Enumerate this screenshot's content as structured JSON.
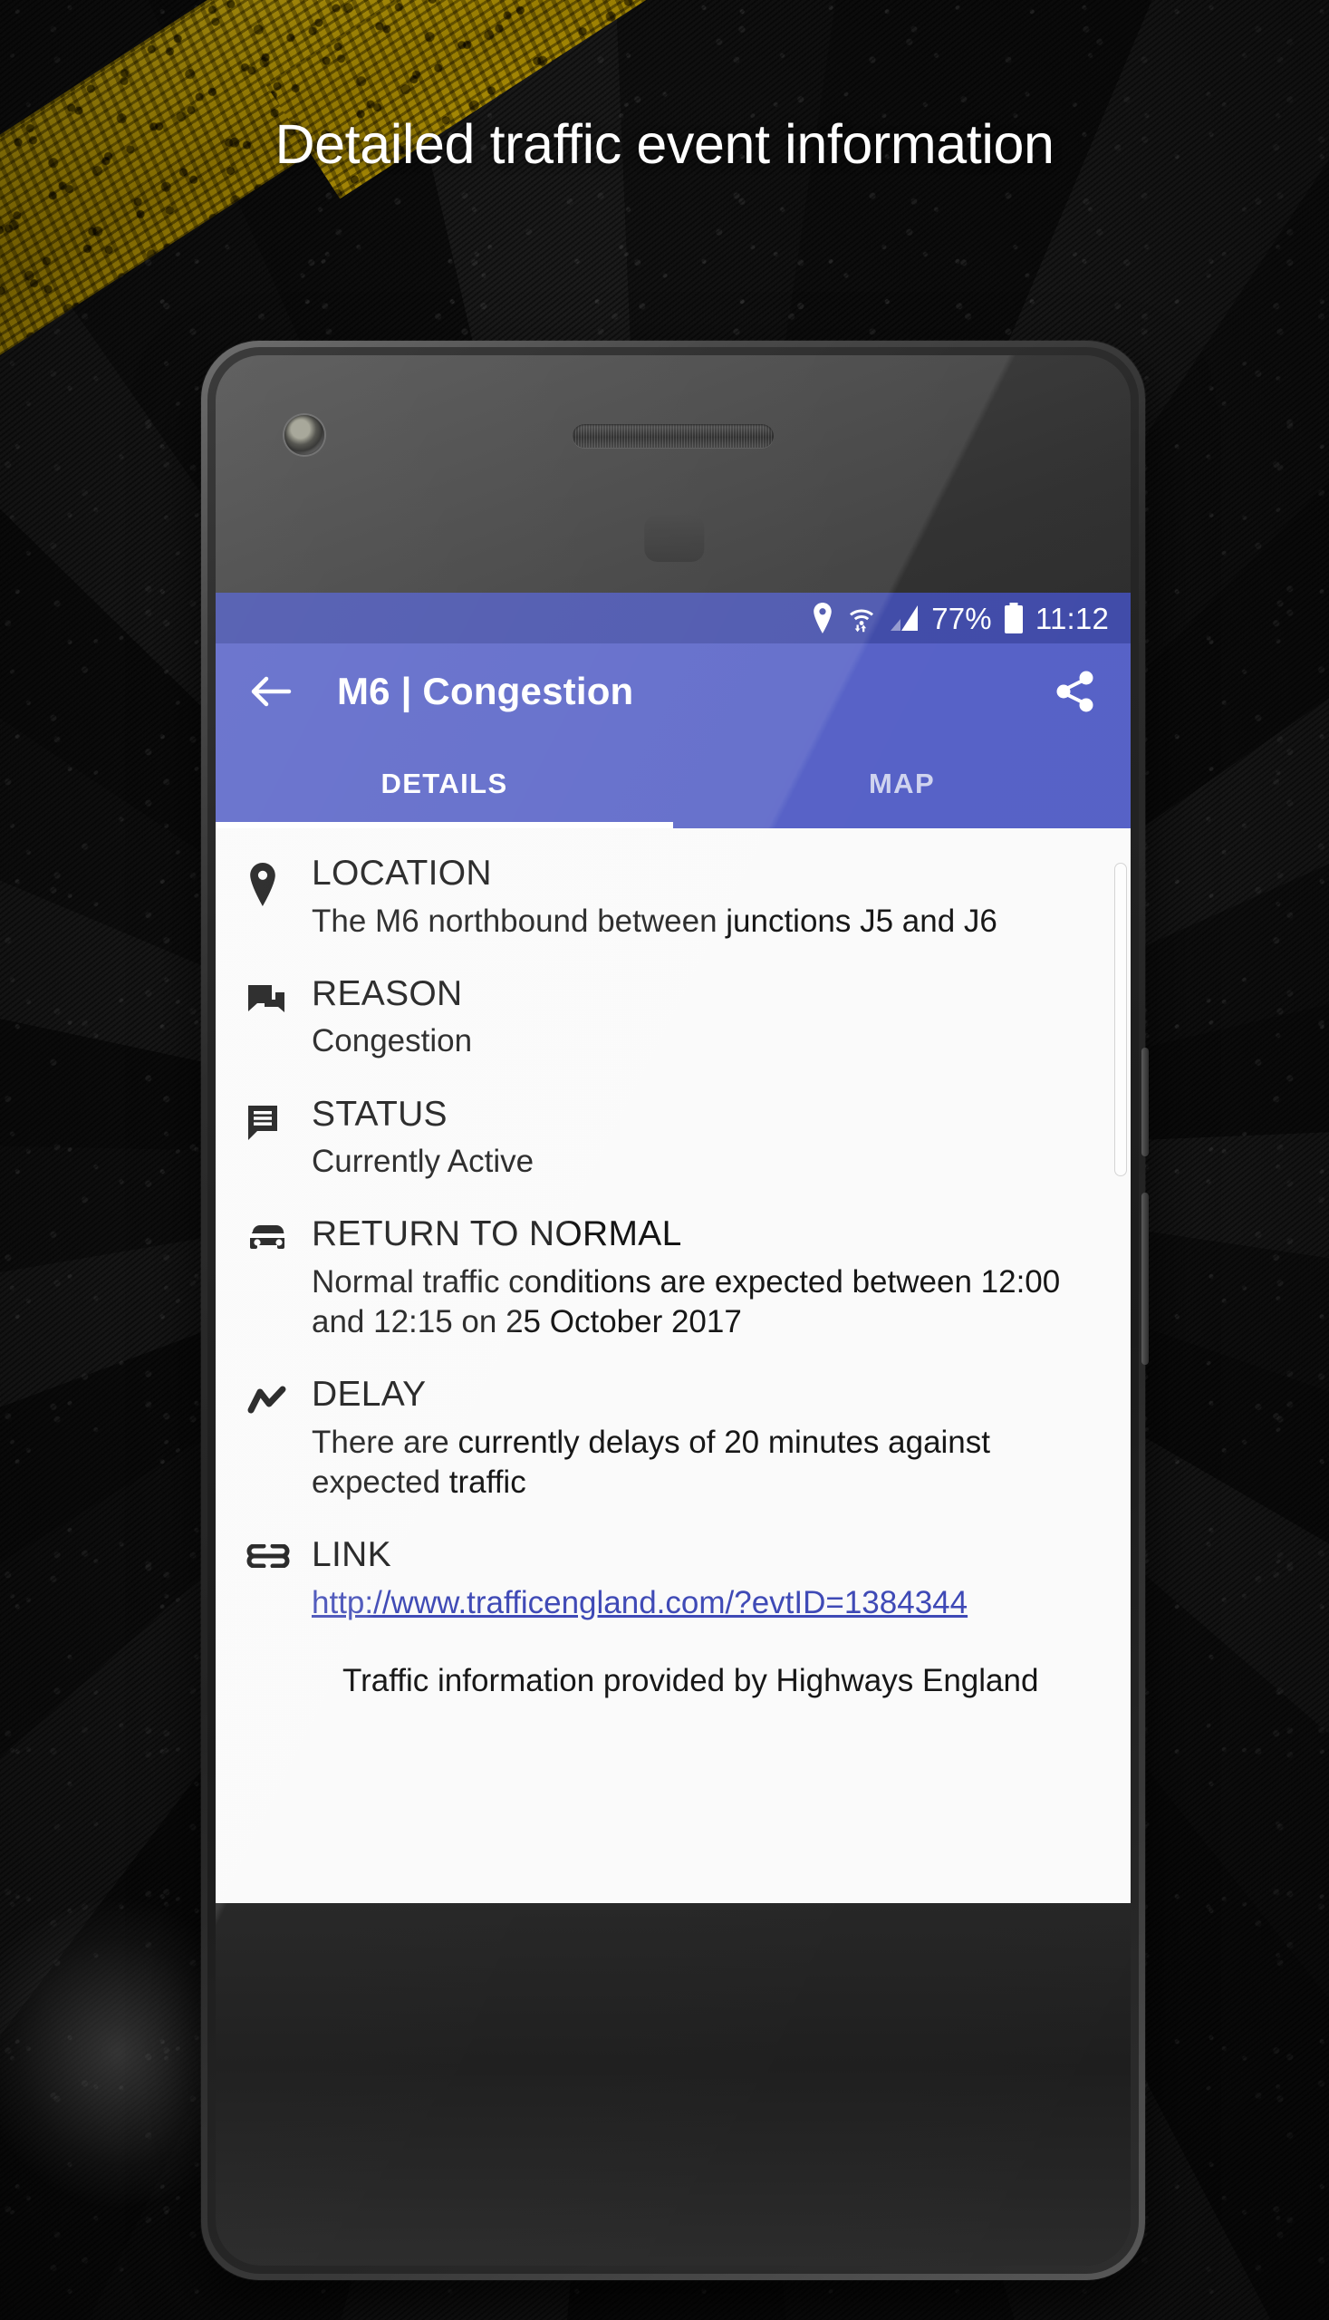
{
  "promo": {
    "headline": "Detailed traffic event information"
  },
  "phone": {
    "statusbar": {
      "icons": [
        "location-pin-icon",
        "wifi-icon",
        "signal-bars-icon",
        "battery-icon"
      ],
      "battery_percent": "77%",
      "time": "11:12"
    },
    "appbar": {
      "back_icon": "arrow-left-icon",
      "title": "M6 | Congestion",
      "share_icon": "share-icon"
    },
    "tabs": [
      {
        "label": "DETAILS",
        "active": true
      },
      {
        "label": "MAP",
        "active": false
      }
    ],
    "details": [
      {
        "icon": "location-pin-icon",
        "label": "LOCATION",
        "value": "The M6 northbound between junctions J5 and J6"
      },
      {
        "icon": "chat-bubble-icon",
        "label": "REASON",
        "value": "Congestion"
      },
      {
        "icon": "comment-lines-icon",
        "label": "STATUS",
        "value": "Currently Active"
      },
      {
        "icon": "car-icon",
        "label": "RETURN TO NORMAL",
        "value": "Normal traffic conditions are expected between 12:00 and 12:15 on 25 October 2017"
      },
      {
        "icon": "trending-zigzag-icon",
        "label": "DELAY",
        "value": "There are currently delays of 20 minutes against expected traffic"
      },
      {
        "icon": "link-chain-icon",
        "label": "LINK",
        "value": "http://www.trafficengland.com/?evtID=1384344",
        "is_link": true
      }
    ],
    "footnote": "Traffic information provided by Highways England"
  },
  "colors": {
    "statusbar_blue": "#3f4aa8",
    "appbar_blue": "#5560c6",
    "link_blue": "#3d48b5",
    "screen_bg": "#fafafa",
    "road_yellow": "#d8b81c"
  }
}
